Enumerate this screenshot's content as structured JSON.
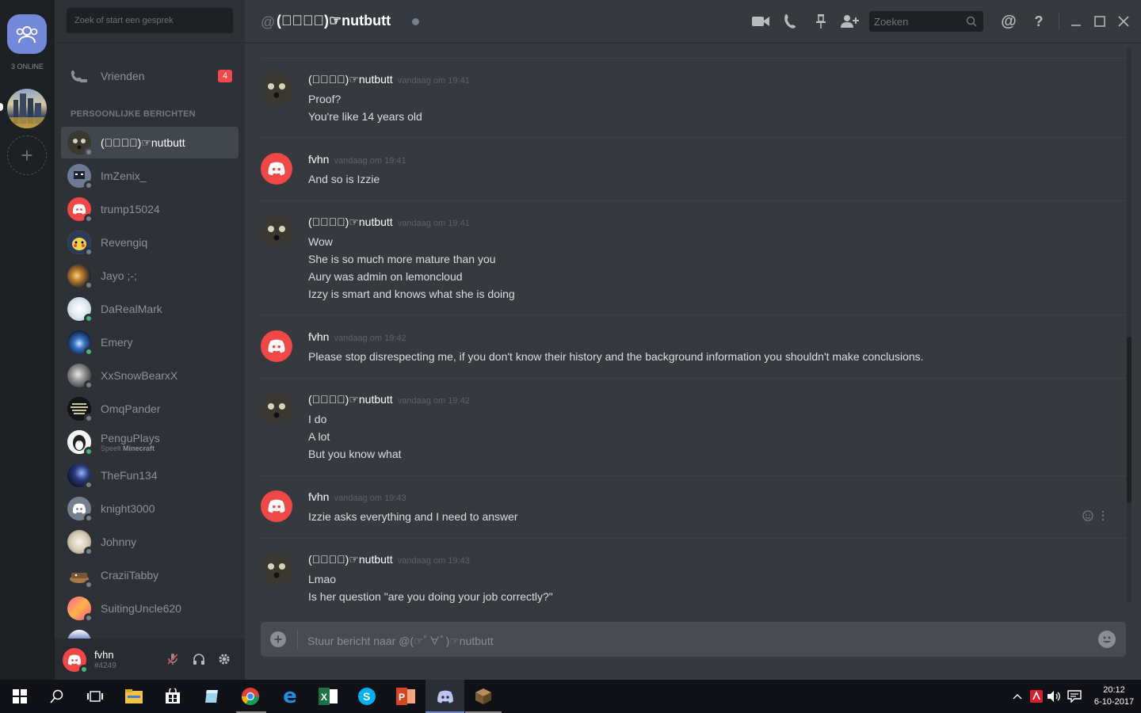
{
  "window": {
    "title": "(☞ﾟ∀ﾟ)☞nutbutt",
    "at_symbol": "@",
    "search_placeholder": "Zoeken"
  },
  "rail": {
    "online_label": "3 ONLINE"
  },
  "sidebar": {
    "search_placeholder": "Zoek of start een gesprek",
    "friends_label": "Vrienden",
    "friends_badge": "4",
    "section_title": "PERSOONLIJKE BERICHTEN",
    "dms": [
      {
        "name": "(☞ﾟ∀ﾟ)☞nutbutt",
        "status": "offline",
        "active": true
      },
      {
        "name": "ImZenix_",
        "status": "offline"
      },
      {
        "name": "trump15024",
        "status": "offline"
      },
      {
        "name": "Revengiq",
        "status": "offline"
      },
      {
        "name": "Jayo ;-;",
        "status": "offline"
      },
      {
        "name": "DaRealMark",
        "status": "online"
      },
      {
        "name": "Emery",
        "status": "online"
      },
      {
        "name": "XxSnowBearxX",
        "status": "offline"
      },
      {
        "name": "OmqPander",
        "status": "offline"
      },
      {
        "name": "PenguPlays",
        "status": "online",
        "activity_prefix": "Speelt",
        "activity": "Minecraft"
      },
      {
        "name": "TheFun134",
        "status": "offline"
      },
      {
        "name": "knight3000",
        "status": "offline"
      },
      {
        "name": "Johnny",
        "status": "offline"
      },
      {
        "name": "CraziiTabby",
        "status": "offline"
      },
      {
        "name": "SuitingUncle620",
        "status": "offline"
      }
    ]
  },
  "user": {
    "name": "fvhn",
    "tag": "#4249"
  },
  "messages": [
    {
      "author": "(☞ﾟ∀ﾟ)☞nutbutt",
      "time": "vandaag om 19:41",
      "lines": [
        "Proof?",
        "You're like 14 years old"
      ]
    },
    {
      "author": "fvhn",
      "time": "vandaag om 19:41",
      "lines": [
        "And so is Izzie"
      ]
    },
    {
      "author": "(☞ﾟ∀ﾟ)☞nutbutt",
      "time": "vandaag om 19:41",
      "lines": [
        "Wow",
        "She is so much more mature than you",
        "Aury was admin on lemoncloud",
        "Izzy is smart and knows what she is doing"
      ]
    },
    {
      "author": "fvhn",
      "time": "vandaag om 19:42",
      "lines": [
        "Please stop disrespecting me, if you don't know their history and the background information you shouldn't make conclusions."
      ]
    },
    {
      "author": "(☞ﾟ∀ﾟ)☞nutbutt",
      "time": "vandaag om 19:42",
      "lines": [
        "I do",
        "A lot",
        "But you know what"
      ]
    },
    {
      "author": "fvhn",
      "time": "vandaag om 19:43",
      "lines": [
        "Izzie asks everything and I need to answer"
      ]
    },
    {
      "author": "(☞ﾟ∀ﾟ)☞nutbutt",
      "time": "vandaag om 19:43",
      "lines": [
        "Lmao",
        "Is her question \"are you doing your job correctly?\""
      ]
    }
  ],
  "composer": {
    "placeholder": "Stuur bericht naar @(☞ﾟ∀ﾟ)☞nutbutt"
  },
  "taskbar": {
    "time": "20:12",
    "date": "6-10-2017"
  },
  "colors": {
    "accent": "#7289da",
    "discord_red": "#f04747",
    "online": "#43b581",
    "offline": "#747f8d"
  }
}
